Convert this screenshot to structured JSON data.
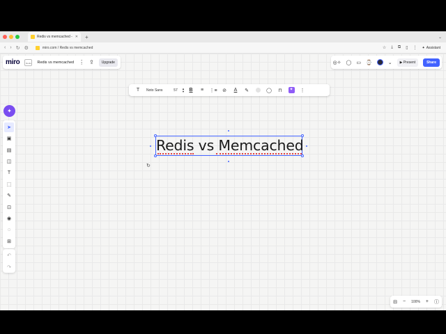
{
  "browser": {
    "traffic_lights": [
      "#ff5f57",
      "#febc2e",
      "#28c840"
    ],
    "tab_title": "Redis vs memcached - Miro",
    "url": "miro.com / Redis vs memcached"
  },
  "miro": {
    "logo": "miro",
    "board_thumb_label": "Redis vs",
    "board_name": "Redis vs memcached",
    "upgrade_label": "Upgrade",
    "present_label": "Present",
    "share_label": "Share",
    "brand_color": "#4262ff"
  },
  "format_toolbar": {
    "font_family": "Noto Sans",
    "font_size": "57"
  },
  "board": {
    "text": "Redis vs Memcached"
  },
  "zoom": {
    "level": "100%"
  },
  "icons": {
    "text_tool": "T",
    "bold": "B",
    "align": "≡",
    "list": "☰",
    "link": "🔗",
    "text_color": "A",
    "highlight": "✎",
    "comment": "◌",
    "lock": "🔒",
    "more": "⋮",
    "minus": "−",
    "plus": "+",
    "help": "?"
  }
}
